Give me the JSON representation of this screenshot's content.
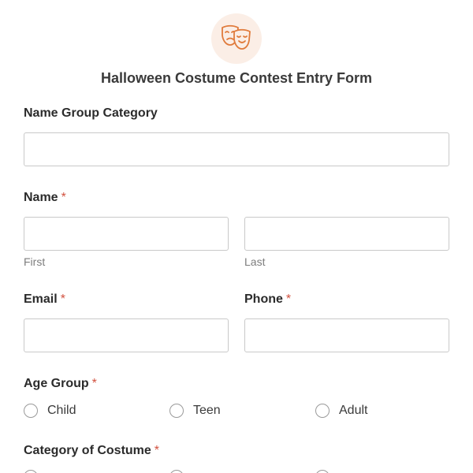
{
  "header": {
    "logo_icon": "theater-masks-icon",
    "accent_color": "#e07b3c",
    "title": "Halloween Costume Contest Entry Form"
  },
  "fields": {
    "name_group_category": {
      "label": "Name Group Category",
      "value": ""
    },
    "name": {
      "label": "Name",
      "required_mark": "*",
      "first_value": "",
      "first_sublabel": "First",
      "last_value": "",
      "last_sublabel": "Last"
    },
    "email": {
      "label": "Email",
      "required_mark": "*",
      "value": ""
    },
    "phone": {
      "label": "Phone",
      "required_mark": "*",
      "value": ""
    },
    "age_group": {
      "label": "Age Group",
      "required_mark": "*",
      "options": [
        "Child",
        "Teen",
        "Adult"
      ]
    },
    "category_of_costume": {
      "label": "Category of Costume",
      "required_mark": "*"
    }
  }
}
